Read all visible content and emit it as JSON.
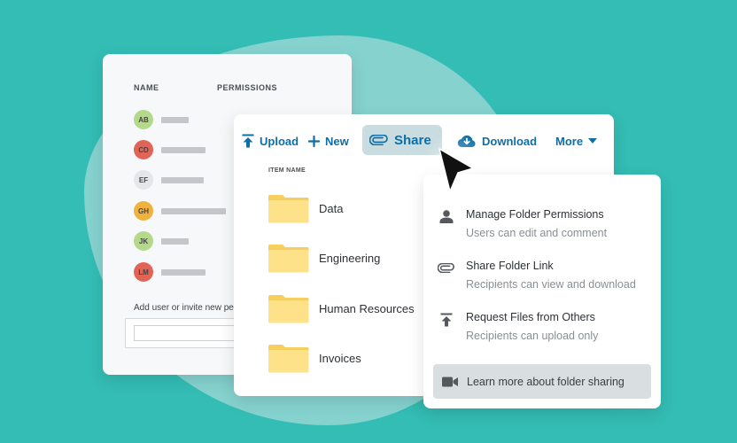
{
  "permissions_panel": {
    "col_name": "NAME",
    "col_permissions": "PERMISSIONS",
    "users": [
      {
        "initials": "AB",
        "color": "#b5d98a",
        "bar": 31
      },
      {
        "initials": "CD",
        "color": "#e16456",
        "bar": 50
      },
      {
        "initials": "EF",
        "color": "#e3e7ea",
        "bar": 48
      },
      {
        "initials": "GH",
        "color": "#f0b23f",
        "bar": 73
      },
      {
        "initials": "JK",
        "color": "#b5d98a",
        "bar": 31
      },
      {
        "initials": "LM",
        "color": "#e16456",
        "bar": 50
      }
    ],
    "add_label": "Add user or invite new pe"
  },
  "toolbar": {
    "upload": "Upload",
    "new": "New",
    "share": "Share",
    "download": "Download",
    "more": "More",
    "accent": "#0e6fa8"
  },
  "files": {
    "header": "ITEM NAME",
    "folders": [
      "Data",
      "Engineering",
      "Human Resources",
      "Invoices"
    ],
    "folder_color": "#fde28a"
  },
  "share_menu": {
    "items": [
      {
        "icon": "person-icon",
        "title": "Manage Folder Permissions",
        "subtitle": "Users can edit and comment"
      },
      {
        "icon": "paperclip-icon",
        "title": "Share Folder Link",
        "subtitle": "Recipients can view and download"
      },
      {
        "icon": "upload-arrow-icon",
        "title": "Request Files from Others",
        "subtitle": "Recipients can upload only"
      }
    ],
    "learn_more": {
      "icon": "video-camera-icon",
      "label": "Learn more about folder sharing"
    }
  }
}
